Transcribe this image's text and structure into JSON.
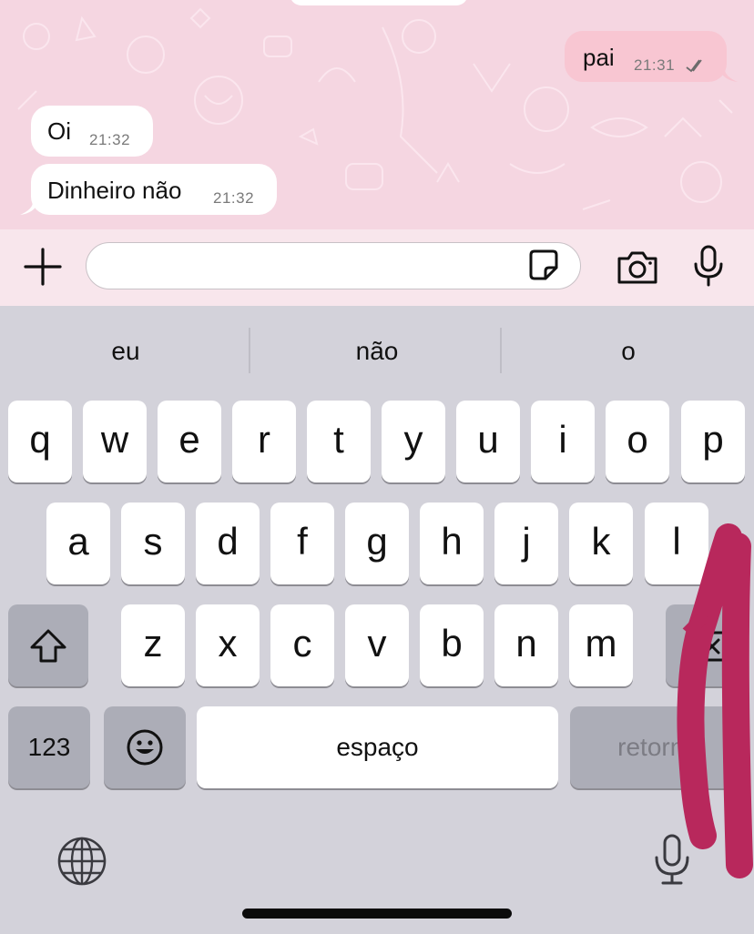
{
  "chat": {
    "messages": [
      {
        "direction": "out",
        "text": "pai",
        "time": "21:31",
        "status": "read-double-check-icon"
      },
      {
        "direction": "in",
        "text": "Oi",
        "time": "21:32"
      },
      {
        "direction": "in",
        "text": "Dinheiro não",
        "time": "21:32"
      }
    ]
  },
  "composer": {
    "add_icon": "plus-icon",
    "sticker_icon": "sticker-icon",
    "camera_icon": "camera-icon",
    "mic_icon": "microphone-icon",
    "input_value": ""
  },
  "keyboard": {
    "suggestions": [
      "eu",
      "não",
      "o"
    ],
    "row1": [
      "q",
      "w",
      "e",
      "r",
      "t",
      "y",
      "u",
      "i",
      "o",
      "p"
    ],
    "row2": [
      "a",
      "s",
      "d",
      "f",
      "g",
      "h",
      "j",
      "k",
      "l"
    ],
    "row3": [
      "z",
      "x",
      "c",
      "v",
      "b",
      "n",
      "m"
    ],
    "numbers_label": "123",
    "space_label": "espaço",
    "return_label": "retorno",
    "icons": [
      "shift-icon",
      "backspace-icon",
      "emoji-icon",
      "globe-icon",
      "dictation-mic-icon"
    ]
  },
  "colors": {
    "chat_bg": "#f5d6e1",
    "outgoing_bubble": "#f8c6d2",
    "annotation": "#b8285c"
  }
}
